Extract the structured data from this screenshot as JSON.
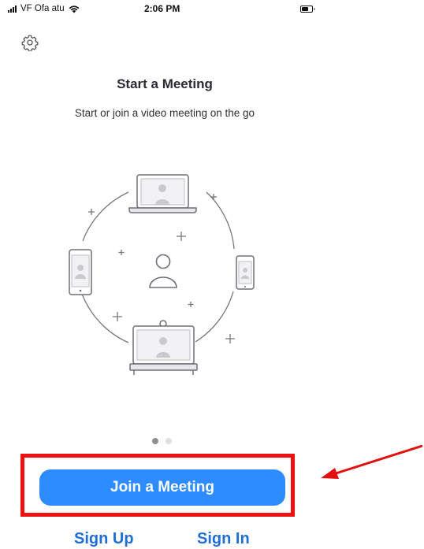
{
  "status_bar": {
    "carrier": "VF Ofa atu",
    "time": "2:06 PM"
  },
  "icons": {
    "settings": "gear-icon",
    "wifi": "wifi-icon",
    "battery": "battery-icon"
  },
  "intro": {
    "title": "Start a Meeting",
    "subtitle": "Start or join a video meeting on the go"
  },
  "pager": {
    "total_pages": 2,
    "current_page": 1
  },
  "actions": {
    "join_label": "Join a Meeting",
    "sign_up_label": "Sign Up",
    "sign_in_label": "Sign In"
  },
  "colors": {
    "primary_blue": "#2d8cff",
    "link_blue": "#1f6fd6",
    "annotation_red": "#ee1111"
  }
}
